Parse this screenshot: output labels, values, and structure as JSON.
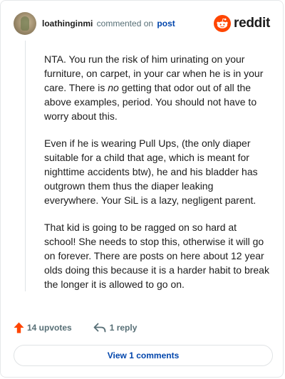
{
  "comment": {
    "username": "loathinginmi",
    "action_text": "commented on",
    "post_link": "post",
    "paragraphs": [
      {
        "before": "NTA. You run the risk of him urinating on your furniture, on carpet, in your car when he is in your care. There is ",
        "emphasis": "no",
        "after": " getting that odor out of all the above examples, period. You should not have to worry about this."
      },
      {
        "text": "Even if he is wearing Pull Ups, (the only diaper suitable for a child that age, which is meant for nighttime accidents btw), he and his bladder has outgrown them thus the diaper leaking everywhere. Your SiL is a lazy, negligent parent."
      },
      {
        "text": "That kid is going to be ragged on so hard at school! She needs to stop this, otherwise it will go on forever. There are posts on here about 12 year olds doing this because it is a harder habit to break the longer it is allowed to go on."
      }
    ],
    "upvotes": "14 upvotes",
    "replies": "1 reply",
    "view_button": "View 1 comments"
  },
  "brand": {
    "logo_text": "reddit",
    "accent_color": "#ff4500",
    "upvote_color": "#ff4500",
    "link_color": "#0045ac"
  },
  "icons": {
    "avatar": "user-avatar",
    "logo": "reddit-snoo-icon",
    "upvote": "upvote-arrow-icon",
    "reply": "reply-arrow-icon"
  }
}
